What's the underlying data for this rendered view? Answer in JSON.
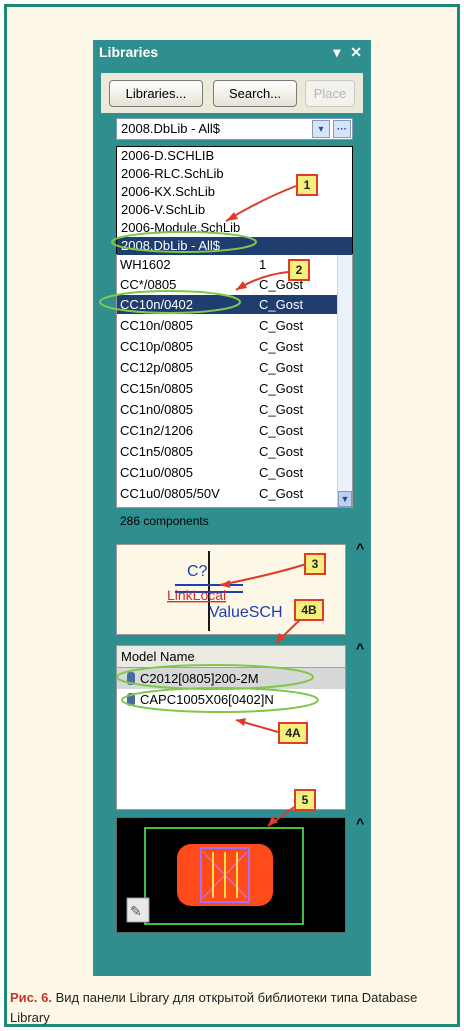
{
  "panel": {
    "title": "Libraries",
    "controls": "▾ ✕"
  },
  "toolbar": {
    "libraries_label": "Libraries...",
    "search_label": "Search...",
    "place_label": "Place"
  },
  "combo": {
    "value": "2008.DbLib - All$",
    "arrow": "▾",
    "more": "···"
  },
  "dropdown": {
    "items": [
      "2006-D.SCHLIB",
      "2006-RLC.SchLib",
      "2006-KX.SchLib",
      "2006-V.SchLib",
      "2006-Module.SchLib",
      "2008.DbLib - All$"
    ]
  },
  "list": {
    "rows": [
      {
        "name": "WH1602",
        "lib": "1"
      },
      {
        "name": "CC*/0805",
        "lib": "C_Gost"
      },
      {
        "name": "CC10n/0402",
        "lib": "C_Gost"
      },
      {
        "name": "CC10n/0805",
        "lib": "C_Gost"
      },
      {
        "name": "CC10p/0805",
        "lib": "C_Gost"
      },
      {
        "name": "CC12p/0805",
        "lib": "C_Gost"
      },
      {
        "name": "CC15n/0805",
        "lib": "C_Gost"
      },
      {
        "name": "CC1n0/0805",
        "lib": "C_Gost"
      },
      {
        "name": "CC1n2/1206",
        "lib": "C_Gost"
      },
      {
        "name": "CC1n5/0805",
        "lib": "C_Gost"
      },
      {
        "name": "CC1u0/0805",
        "lib": "C_Gost"
      },
      {
        "name": "CC1u0/0805/50V",
        "lib": "C_Gost"
      }
    ],
    "count": "286 components"
  },
  "symbol": {
    "designator": "C?",
    "link": "LinkLocal",
    "value": "ValueSCH"
  },
  "models": {
    "header": "Model Name",
    "items": [
      "C2012[0805]200-2M",
      "CAPC1005X06[0402]N"
    ]
  },
  "callouts": {
    "c1": "1",
    "c2": "2",
    "c3": "3",
    "c4b": "4B",
    "c4a": "4A",
    "c5": "5"
  },
  "caption": {
    "prefix": "Рис. 6.",
    "text": " Вид панели Library для открытой библиотеки типа Database Library"
  },
  "colors": {
    "selection": "#1f3d6e",
    "callout_border": "#e03a2a",
    "callout_fill": "#f5ef7d",
    "ellipse": "#7ec84a",
    "frame": "#1d8a73",
    "panel": "#2f8f8f"
  }
}
